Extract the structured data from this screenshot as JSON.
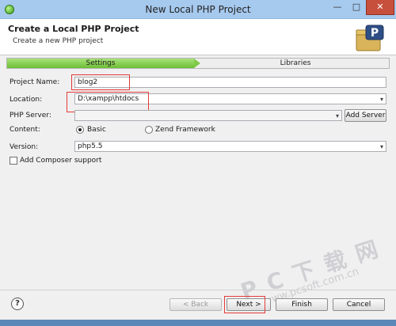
{
  "window": {
    "title": "New Local PHP Project",
    "minimize_glyph": "—",
    "maximize_glyph": "□",
    "close_glyph": "✕",
    "icon": "eclipse-app-icon"
  },
  "header": {
    "title": "Create a Local PHP Project",
    "description": "Create a new PHP project",
    "icon": "php-folder-icon"
  },
  "steps": [
    {
      "label": "Settings",
      "active": true
    },
    {
      "label": "Libraries",
      "active": false
    }
  ],
  "form": {
    "project_name": {
      "label": "Project Name:",
      "value": "blog2"
    },
    "location": {
      "label": "Location:",
      "value": "D:\\xampp\\htdocs"
    },
    "php_server": {
      "label": "PHP Server:",
      "value": "",
      "add_button": "Add Server"
    },
    "content": {
      "label": "Content:",
      "options": [
        "Basic",
        "Zend Framework"
      ],
      "selected": "Basic"
    },
    "version": {
      "label": "Version:",
      "value": "php5.5"
    },
    "composer": {
      "label": "Add Composer support",
      "checked": false
    }
  },
  "footer": {
    "help": "?",
    "back": "< Back",
    "next": "Next >",
    "finish": "Finish",
    "cancel": "Cancel"
  },
  "watermark": {
    "main": "P C 下 载 网",
    "url": "www.pcsoft.com.cn"
  },
  "colors": {
    "titlebar": "#a6c9ee",
    "step_active": "#6cbf35",
    "highlight_red": "#e53a3a",
    "close_button": "#c7503c"
  }
}
